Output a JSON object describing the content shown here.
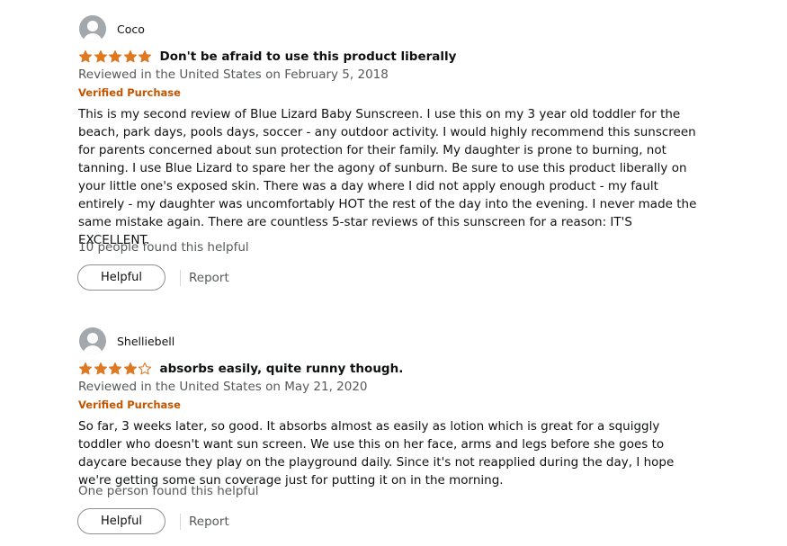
{
  "colors": {
    "star_fill": "#de7921",
    "star_empty": "#ffffff",
    "star_outline": "#de7921",
    "verified": "#c45500",
    "muted_text": "#565959",
    "text": "#0f1111",
    "avatar": "#a3a8ad"
  },
  "icons": {
    "avatar": "person-silhouette-icon",
    "star": "star-icon"
  },
  "reviews": [
    {
      "author": "Coco",
      "rating": 5,
      "rating_max": 5,
      "title": "Don't be afraid to use this product liberally",
      "date": "Reviewed in the United States on February 5, 2018",
      "verified": "Verified Purchase",
      "body": "This is my second review of Blue Lizard Baby Sunscreen. I use this on my 3 year old toddler for the beach, park days, pools days, soccer - any outdoor activity. I would highly recommend this sunscreen for parents concerned about sun protection for their family. My daughter is prone to burning, not tanning. I use Blue Lizard to spare her the agony of sunburn. Be sure to use this product liberally on your little one's exposed skin. There was a day where I did not apply enough product - my fault entirely - my daughter was uncomfortably HOT the rest of the day into the evening. I never made the same mistake again. There are countless 5-star reviews of this sunscreen for a reason: IT'S EXCELLENT.",
      "helpful_count_text": "10 people found this helpful",
      "helpful_button": "Helpful",
      "report_link": "Report"
    },
    {
      "author": "Shelliebell",
      "rating": 4,
      "rating_max": 5,
      "title": "absorbs easily, quite runny though.",
      "date": "Reviewed in the United States on May 21, 2020",
      "verified": "Verified Purchase",
      "body": "So far, 3 weeks later, so good. It absorbs almost as easily as lotion which is great for a squiggly toddler who doesn't want sun screen. We use this on her face, arms and legs before she goes to daycare because they play on the playground daily. Since it's not reapplied during the day, I hope we're getting some sun coverage just for putting it on in the morning.",
      "helpful_count_text": "One person found this helpful",
      "helpful_button": "Helpful",
      "report_link": "Report"
    }
  ]
}
